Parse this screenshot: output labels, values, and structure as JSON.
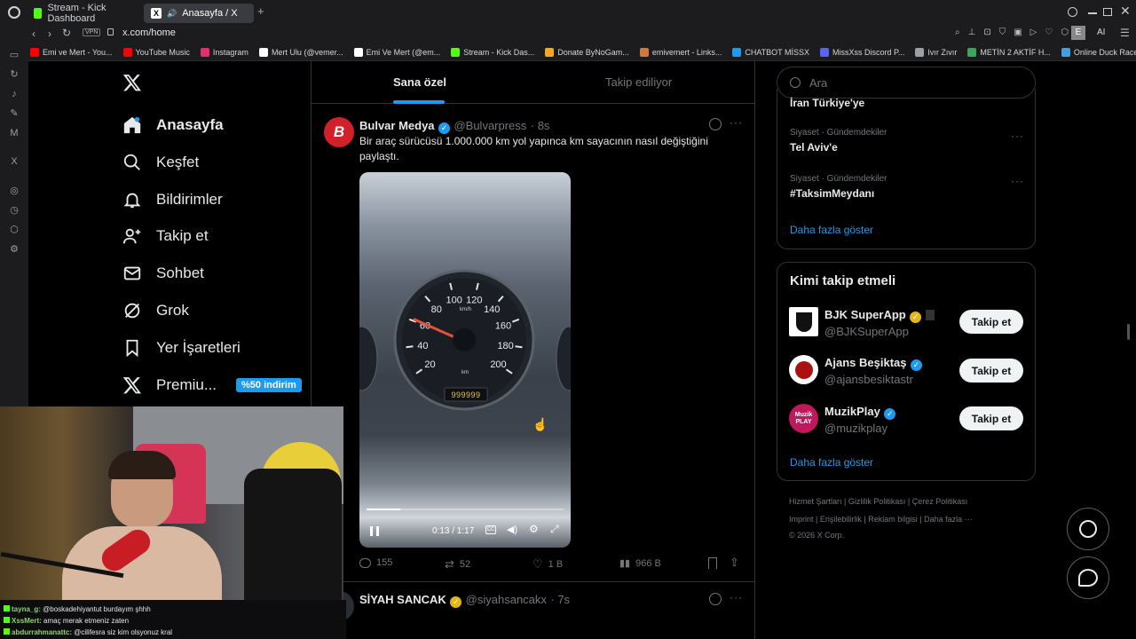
{
  "browser": {
    "tabs": [
      {
        "label": "Stream - Kick Dashboard",
        "active": false
      },
      {
        "label": "Anasayfa / X",
        "active": true
      }
    ],
    "vpn_badge": "VPN",
    "url": "x.com/home",
    "profile_initial": "E",
    "ai_label": "AI",
    "bookmarks": [
      "Emi ve Mert - You...",
      "YouTube Music",
      "Instagram",
      "Mert Ulu (@vemer...",
      "Emi Ve Mert (@em...",
      "Stream - Kick Das...",
      "Donate ByNoGam...",
      "emivemert - Links...",
      "CHATBOT MİSSX",
      "MissXss Discord P...",
      "Ivır Zıvır",
      "METİN 2 AKTİF H...",
      "Online Duck Race..."
    ]
  },
  "nav": {
    "items": [
      {
        "label": "Anasayfa",
        "icon": "home-icon"
      },
      {
        "label": "Keşfet",
        "icon": "search-icon"
      },
      {
        "label": "Bildirimler",
        "icon": "bell-icon"
      },
      {
        "label": "Takip et",
        "icon": "person-add-icon"
      },
      {
        "label": "Sohbet",
        "icon": "mail-icon"
      },
      {
        "label": "Grok",
        "icon": "grok-icon"
      },
      {
        "label": "Yer İşaretleri",
        "icon": "bookmark-icon"
      },
      {
        "label": "Premiu...",
        "icon": "x-logo-icon"
      }
    ],
    "premium_badge": "%50 indirim"
  },
  "feed": {
    "tabs": [
      "Sana özel",
      "Takip ediliyor"
    ],
    "post": {
      "author": "Bulvar Medya",
      "handle": "@Bulvarpress",
      "time": "· 8s",
      "text": "Bir araç sürücüsü 1.000.000 km yol yapınca km sayacının nasıl değiştiğini paylaştı.",
      "video_time": "0:13 / 1:17",
      "video_progress": 0.17,
      "odometer": "999999",
      "gauge_labels": [
        "20",
        "40",
        "60",
        "80",
        "100",
        "120",
        "140",
        "160",
        "180",
        "200"
      ],
      "gauge_unit": "km/h",
      "gauge_km": "km",
      "stats": {
        "replies": "155",
        "reposts": "52",
        "likes": "1 B",
        "views": "966 B"
      }
    },
    "next_post": {
      "author": "SİYAH SANCAK",
      "handle": "@siyahsancakx",
      "time": "· 7s"
    }
  },
  "sidebar": {
    "search_placeholder": "Ara",
    "trends_partial": "İran Türkiye'ye",
    "trends": [
      {
        "category": "Siyaset · Gündemdekiler",
        "name": "Tel Aviv'e"
      },
      {
        "category": "Siyaset · Gündemdekiler",
        "name": "#TaksimMeydanı"
      }
    ],
    "trends_more": "Daha fazla göster",
    "who_to_follow_title": "Kimi takip etmeli",
    "suggestions": [
      {
        "name": "BJK SuperApp",
        "handle": "@BJKSuperApp",
        "button": "Takip et",
        "badge": "gold"
      },
      {
        "name": "Ajans Beşiktaş",
        "handle": "@ajansbesiktastr",
        "button": "Takip et",
        "badge": "blue"
      },
      {
        "name": "MuzikPlay",
        "handle": "@muzikplay",
        "button": "Takip et",
        "badge": "blue"
      }
    ],
    "muzikplay_logo": "Muzik PLAY",
    "suggestions_more": "Daha fazla göster",
    "footer_row1": [
      "Hizmet Şartları",
      "Gizlilik Politikası",
      "Çerez Politikası"
    ],
    "footer_row2": [
      "Imprint",
      "Erişilebilirlik",
      "Reklam bilgisi",
      "Daha fazla ···"
    ],
    "copyright": "© 2026 X Corp."
  },
  "chat": {
    "lines": [
      {
        "user": "tayna_g:",
        "text": "@boskadehiyantut burdayım şhhh"
      },
      {
        "user": "XssMert:",
        "text": "amaç merak etmeniz zaten"
      },
      {
        "user": "abdurrahmanattc:",
        "text": "@cilifesra siz kim olsyonuz kral"
      }
    ]
  },
  "colors": {
    "accent": "#1d9bf0",
    "background": "#000000",
    "border": "#2f3336",
    "muted": "#71767b"
  }
}
